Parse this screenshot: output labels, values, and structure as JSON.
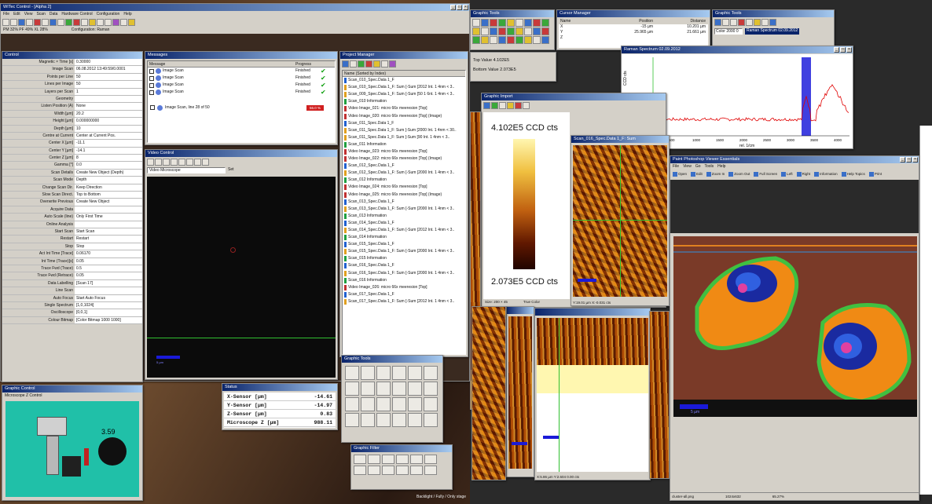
{
  "colors": {
    "title_bar": "#0a246a",
    "plot_bg": "#ffffff",
    "spectrum": "#e00000",
    "highlight_band": "#4040e0",
    "cell_bg": "#7a3a28",
    "scalebar": "#1a1ad8"
  },
  "main_win": {
    "title": "WITec Control - [Alpha 2]",
    "menu": [
      "File",
      "Edit",
      "View",
      "Scan",
      "Data",
      "Hardware Control",
      "Configuration",
      "Help"
    ],
    "status": [
      "PM 32% PF 49% XL 28%",
      "Configuration: Raman"
    ]
  },
  "props": {
    "title": "Control",
    "rows": [
      [
        "Magnetic × Time [s]",
        "0.30000"
      ],
      [
        "Image Scan",
        "06.08.2012 13:49:59/0.0001"
      ],
      [
        "Points per Line",
        "50"
      ],
      [
        "Lines per Image",
        "50"
      ],
      [
        "Layers per Scan",
        "1"
      ],
      [
        "Geometry",
        ""
      ],
      [
        "Listen Position (A)",
        "None"
      ],
      [
        "Width [µm]",
        "20.2"
      ],
      [
        "Height [µm]",
        "0.000000000"
      ],
      [
        "Depth [µm]",
        "10"
      ],
      [
        "Centre at Current",
        "Center at Current Pos."
      ],
      [
        "Center X [µm]",
        "-11.1"
      ],
      [
        "Center Y [µm]",
        "-14.1"
      ],
      [
        "Center Z [µm]",
        "8"
      ],
      [
        "Gamma [°]",
        "0.0"
      ],
      [
        "Scan Details",
        "Create New Object (Depth)"
      ],
      [
        "Scan Mode",
        "Depth"
      ],
      [
        "Change Scan Dir.",
        "Keep Direction"
      ],
      [
        "Slow Scan Direct.",
        "Top to Bottom"
      ],
      [
        "Overwrite Previous",
        "Create New Object"
      ],
      [
        "Acquire Data",
        ""
      ],
      [
        "Auto Scale (line)",
        "Only First Time"
      ],
      [
        "Online Analysis",
        ""
      ],
      [
        "Start Scan",
        "Start Scan"
      ],
      [
        "Restart",
        "Restart"
      ],
      [
        "Stop",
        "Stop"
      ],
      [
        "Act Int Time [Trace]",
        "0.06170"
      ],
      [
        "Int Time (Trace)[s]",
        "0.05"
      ],
      [
        "Trace Fwd (Trace)",
        "0.5"
      ],
      [
        "Trace Fwd (Retrace)",
        "0.05"
      ],
      [
        "Data Labelling",
        "[Scan 17]"
      ],
      [
        "Line Scan",
        ""
      ],
      [
        "Auto Focus",
        "Start Auto Focus"
      ],
      [
        "Single Spectrum",
        "[1,0,1024]"
      ],
      [
        "Oscilloscope",
        "[0,0,1]"
      ],
      [
        "Colour Bitmap",
        "[Color Bitmap 1000 1000]"
      ]
    ]
  },
  "msg": {
    "title": "Messages",
    "col_msg": "Message",
    "col_prog": "Progress",
    "rows": [
      [
        "Image Scan",
        "Finished"
      ],
      [
        "Image Scan",
        "Finished"
      ],
      [
        "Image Scan",
        "Finished"
      ],
      [
        "Image Scan",
        "Finished"
      ]
    ],
    "active": "Image Scan, line 28 of 50",
    "active_prog": "56.0 %"
  },
  "video": {
    "title": "Video Control",
    "dropdown": "Video Microscope",
    "right": "Set",
    "scale": "5 µm"
  },
  "pm": {
    "title": "Project Manager",
    "col": "Name (Sorted by Index)",
    "items": [
      [
        "Scan_010_Spec.Data 1_F",
        1
      ],
      [
        "Scan_010_Spec.Data 1_F: Sum [-Sum [2012 Int. 1 4nm < 3..",
        0
      ],
      [
        "Scan_009_Spec.Data 1_F: Sum [-Sum [50 1 6nt. 1 4nm < 3..",
        0
      ],
      [
        "Scan_010 Information",
        2
      ],
      [
        "Video Image_021: micro 66x meeresion [Top]",
        3
      ],
      [
        "Video Image_020: micro 66x meeresion [Top] (Image)",
        3
      ],
      [
        "Scan_011_Spec.Data 1_F",
        1
      ],
      [
        "Scan_011_Spec.Data 1_F: Sum [-Sum [2000 Int. 1 4nm < 30..",
        0
      ],
      [
        "Scan_011_Spec.Data 1_F: Sum [-Sum [90 Int. 1 4nm < 3..",
        0
      ],
      [
        "Scan_011 Information",
        2
      ],
      [
        "Video Image_023: micro 66x meeresion [Top]",
        3
      ],
      [
        "Video Image_022: micro 66x meeresion [Top] (Image)",
        3
      ],
      [
        "Scan_012_Spec.Data 1_F",
        1
      ],
      [
        "Scan_012_Spec.Data 1_F: Sum [-Sum [2000 Int. 1 4nm < 3..",
        0
      ],
      [
        "Scan_012 Information",
        2
      ],
      [
        "Video Image_024: micro 66x meeresion [Top]",
        3
      ],
      [
        "Video Image_025: micro 66x meeresion [Top] (Image)",
        3
      ],
      [
        "Scan_013_Spec.Data 1_F",
        1
      ],
      [
        "Scan_013_Spec.Data 1_F: Sum [-Sum [2000 Int. 1 4nm < 3..",
        0
      ],
      [
        "Scan_013 Information",
        2
      ],
      [
        "Scan_014_Spec.Data 1_F",
        1
      ],
      [
        "Scan_014_Spec.Data 1_F: Sum [-Sum [2012 Int. 1 4nm < 3..",
        0
      ],
      [
        "Scan_014 Information",
        2
      ],
      [
        "Scan_015_Spec.Data 1_F",
        1
      ],
      [
        "Scan_015_Spec.Data 1_F: Sum [-Sum [2000 Int. 1 4nm < 3..",
        0
      ],
      [
        "Scan_015 Information",
        2
      ],
      [
        "Scan_016_Spec.Data 1_F",
        1
      ],
      [
        "Scan_016_Spec.Data 1_F: Sum [-Sum [2000 Int. 1 4nm < 3..",
        0
      ],
      [
        "Scan_016 Information",
        2
      ],
      [
        "Video Image_026: micro 66x meeresion [Top]",
        3
      ],
      [
        "Scan_017_Spec.Data 1_F",
        1
      ],
      [
        "Scan_017_Spec.Data 1_F: Sum [-Sum [2012 Int. 1 4nm < 3..",
        0
      ]
    ]
  },
  "scopes": {
    "title": "Graphic Control",
    "tab": "Microscope Z Control",
    "value": "3.59"
  },
  "sensor": {
    "title": "Status",
    "rows": [
      [
        "X-Sensor [µm]",
        "-14.61"
      ],
      [
        "Y-Sensor [µm]",
        "-14.97"
      ],
      [
        "Z-Sensor [µm]",
        "0.83"
      ],
      [
        "Microscope Z [µm]",
        "988.11"
      ]
    ]
  },
  "misc": {
    "palette1_title": "Graphic Tools",
    "palette2_title": "Graphic Filter",
    "footer": "Backlight / Fully / Only stage"
  },
  "cursor": {
    "title": "Cursor Manager",
    "headers": [
      "Name",
      "Position",
      "Distance"
    ],
    "rows": [
      [
        "X",
        "-15 µm",
        "10.201 µm"
      ],
      [
        "Y",
        "25.965 µm",
        "21.661 µm"
      ],
      [
        "Z",
        "",
        ""
      ]
    ]
  },
  "spec": {
    "title": "Raman Spectrum 02.09.2012",
    "ylabel": "CCD cts",
    "xlabel": "rel. 1/cm",
    "xticks": [
      "500",
      "1000",
      "1500",
      "2000",
      "2500",
      "3000",
      "3500",
      "4000"
    ],
    "top_value": "Top Value 4.102E5",
    "bottom_value": "Bottom Value 2.073E5",
    "tool_title": "Graphic Tools",
    "tool_select": "Color 2000 0",
    "tool_label": "Raman Spectrum 02.09.2012"
  },
  "cbar": {
    "title": "Graphic Import",
    "max": "4.102E5 CCD cts",
    "min": "2.073E5 CCD cts",
    "size": "Size: 200 × 45",
    "mode": "True Color"
  },
  "img1": {
    "title": "Scan_016_Spec.Data 1_F: Sum",
    "status": "Y:19.01 µm X:-0.031 cts"
  },
  "img3": {
    "status": "X:5.86 µm Y:2.604 0.00 cts"
  },
  "photo": {
    "title": "Paint Photoshop Viewer Essentials",
    "menu": [
      "File",
      "View",
      "Go",
      "Tools",
      "Help"
    ],
    "buttons": [
      "Open",
      "Edit",
      "Zoom In",
      "Zoom Out",
      "Full Screen",
      "Left",
      "Right",
      "Information",
      "Help Topics",
      "Print"
    ],
    "scale": "5 µm",
    "status": [
      "cluster-all.png",
      "1024x632",
      "65.27%"
    ]
  }
}
